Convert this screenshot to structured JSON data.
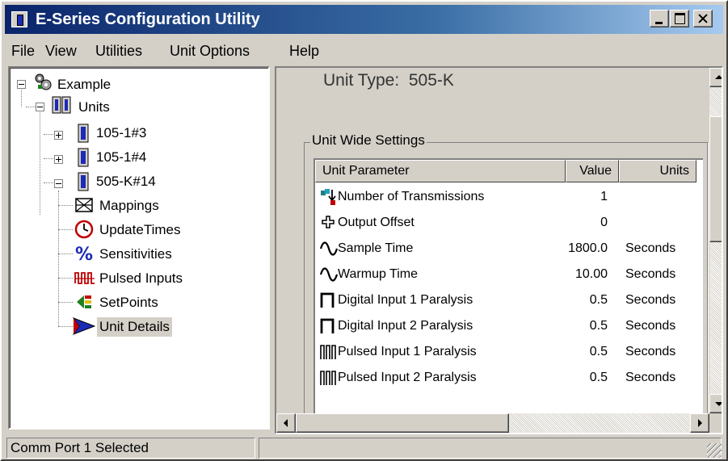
{
  "window": {
    "title": "E-Series Configuration Utility"
  },
  "menu": [
    {
      "label": "File"
    },
    {
      "label": "View"
    },
    {
      "label": "Utilities"
    },
    {
      "label": "Unit Options"
    },
    {
      "label": "Help"
    }
  ],
  "tree": {
    "root": "Example",
    "units": "Units",
    "unit_a": "105-1#3",
    "unit_b": "105-1#4",
    "unit_c": "505-K#14",
    "children": [
      "Mappings",
      "UpdateTimes",
      "Sensitivities",
      "Pulsed Inputs",
      "SetPoints",
      "Unit Details"
    ],
    "selected": "Unit Details"
  },
  "details": {
    "unit_type_label": "Unit Type:",
    "unit_type_value": "505-K",
    "group_title": "Unit Wide Settings",
    "columns": [
      "Unit Parameter",
      "Value",
      "Units"
    ],
    "rows": [
      {
        "param": "Number of Transmissions",
        "value": "1",
        "units": "",
        "icon": "transmissions-icon"
      },
      {
        "param": "Output Offset",
        "value": "0",
        "units": "",
        "icon": "offset-cross-icon"
      },
      {
        "param": "Sample Time",
        "value": "1800.0",
        "units": "Seconds",
        "icon": "wave-icon"
      },
      {
        "param": "Warmup Time",
        "value": "10.00",
        "units": "Seconds",
        "icon": "wave-icon"
      },
      {
        "param": "Digital Input 1 Paralysis",
        "value": "0.5",
        "units": "Seconds",
        "icon": "square-pulse-icon"
      },
      {
        "param": "Digital Input 2 Paralysis",
        "value": "0.5",
        "units": "Seconds",
        "icon": "square-pulse-icon"
      },
      {
        "param": "Pulsed Input 1 Paralysis",
        "value": "0.5",
        "units": "Seconds",
        "icon": "pulse-train-icon"
      },
      {
        "param": "Pulsed Input 2 Paralysis",
        "value": "0.5",
        "units": "Seconds",
        "icon": "pulse-train-icon"
      }
    ]
  },
  "status": {
    "pane1": "Comm Port 1 Selected",
    "pane2": ""
  },
  "colors": {
    "title_bar_start": "#0a246a",
    "title_bar_end": "#a6caf0",
    "face": "#d4d0c8"
  }
}
